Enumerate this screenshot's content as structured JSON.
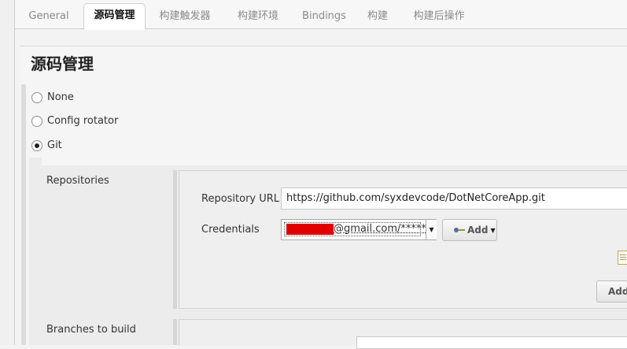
{
  "tabs": [
    {
      "label": "General",
      "active": false
    },
    {
      "label": "源码管理",
      "active": true
    },
    {
      "label": "构建触发器",
      "active": false
    },
    {
      "label": "构建环境",
      "active": false
    },
    {
      "label": "Bindings",
      "active": false
    },
    {
      "label": "构建",
      "active": false
    },
    {
      "label": "构建后操作",
      "active": false
    }
  ],
  "section": {
    "title": "源码管理"
  },
  "scm_options": [
    {
      "label": "None",
      "selected": false
    },
    {
      "label": "Config rotator",
      "selected": false
    },
    {
      "label": "Git",
      "selected": true
    }
  ],
  "git": {
    "repositories_label": "Repositories",
    "repo_url_label": "Repository URL",
    "repo_url_value": "https://github.com/syxdevcode/DotNetCoreApp.git",
    "credentials_label": "Credentials",
    "credentials_value": "@gmail.com/******",
    "add_credentials_label": "Add",
    "add_repository_label": "Add",
    "branches_label": "Branches to build"
  },
  "colors": {
    "redaction": "#e00000",
    "active_tab_bg": "#ffffff"
  }
}
